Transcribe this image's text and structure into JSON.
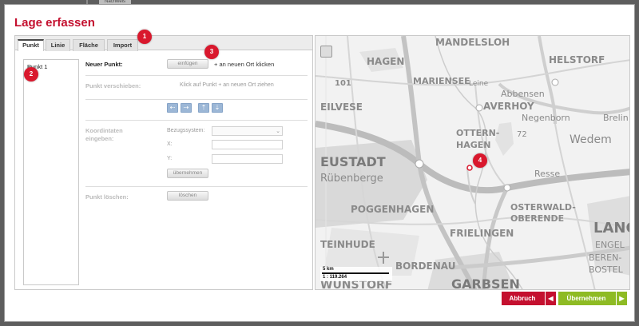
{
  "background": {
    "tab_label": "Nachweis"
  },
  "dialog": {
    "title": "Lage erfassen",
    "tabs": [
      "Punkt",
      "Linie",
      "Fläche",
      "Import"
    ],
    "point_list": [
      "Punkt 1"
    ],
    "new_point": {
      "label": "Neuer Punkt:",
      "button": "einfügen",
      "hint": "+ an neuen Ort klicken"
    },
    "move_point": {
      "label": "Punkt verschieben:",
      "hint": "Klick auf Punkt + an neuen Ort ziehen"
    },
    "coordinates": {
      "label_line1": "Koordintaten",
      "label_line2": "eingeben:",
      "system_label": "Bezugssystem:",
      "x_label": "X:",
      "y_label": "Y:",
      "apply_button": "übernehmen"
    },
    "delete_point": {
      "label": "Punkt löschen:",
      "button": "löschen"
    },
    "map": {
      "scale_text": "5 km",
      "scale_ratio": "1 : 119.264",
      "place_labels": [
        "MANDELSLOH",
        "HAGEN",
        "HELSTORF",
        "MARIENSEE",
        "Leine",
        "Abbensen",
        "101",
        "EILVESE",
        "AVERHOY",
        "Negenborn",
        "Brelin",
        "OTTERN-",
        "HAGEN",
        "72",
        "Wedem",
        "EUSTADT",
        "Rübenberge",
        "Resse",
        "POGGENHAGEN",
        "OSTERWALD-",
        "OBERENDE",
        "LANG",
        "ENGEL",
        "BEREN-",
        "BOSTEL",
        "FRIELINGEN",
        "TEINHUDE",
        "BORDENAU",
        "WUNSTORF",
        "GARBSEN"
      ]
    },
    "markers": [
      "1",
      "2",
      "3",
      "4"
    ],
    "buttons": {
      "cancel": "Abbruch",
      "accept": "Übernehmen"
    }
  },
  "colors": {
    "accent_red": "#c4102f",
    "accent_green": "#8ebb24",
    "nav_blue": "#9cb7d6"
  },
  "icons": {
    "back": "arrow-left-icon",
    "forward": "arrow-right-icon",
    "up": "arrow-up-icon",
    "down": "arrow-down-icon",
    "cancel": "chevron-left-icon",
    "accept": "chevron-right-icon"
  }
}
